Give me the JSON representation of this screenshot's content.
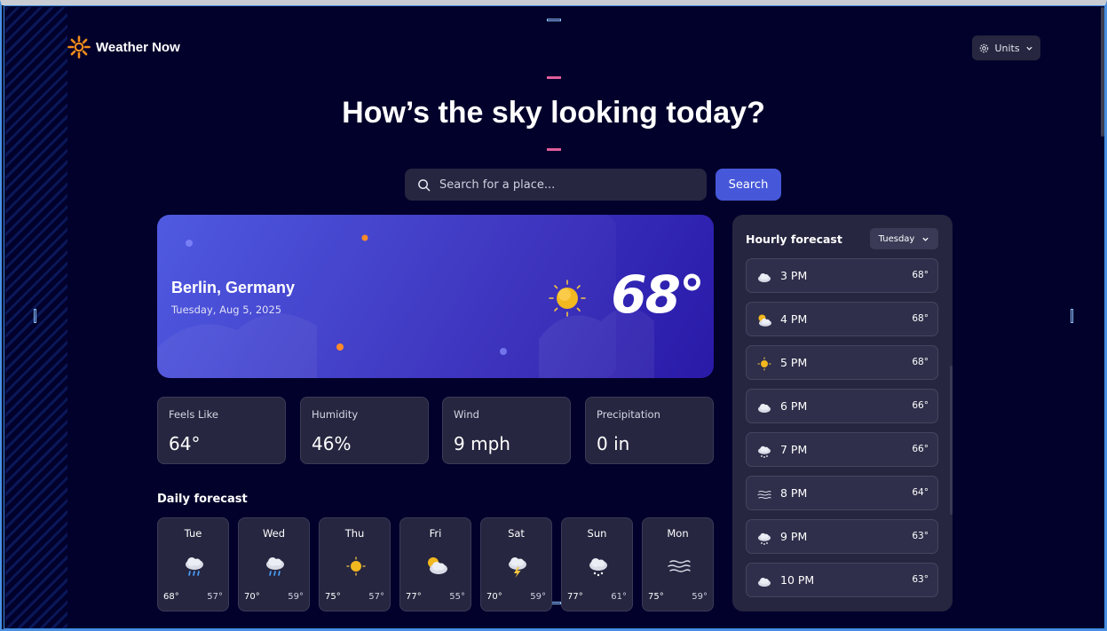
{
  "app": {
    "title": "Weather Now",
    "units_label": "Units"
  },
  "hero": {
    "title": "How’s the sky looking today?"
  },
  "search": {
    "placeholder": "Search for a place...",
    "button_label": "Search"
  },
  "current": {
    "city": "Berlin, Germany",
    "date": "Tuesday, Aug 5, 2025",
    "temp": "68°",
    "icon": "sun-icon"
  },
  "stats": [
    {
      "label": "Feels Like",
      "value": "64°"
    },
    {
      "label": "Humidity",
      "value": "46%"
    },
    {
      "label": "Wind",
      "value": "9 mph"
    },
    {
      "label": "Precipitation",
      "value": "0 in"
    }
  ],
  "daily": {
    "title": "Daily forecast",
    "days": [
      {
        "name": "Tue",
        "hi": "68°",
        "lo": "57°",
        "icon": "rain-cloud-icon"
      },
      {
        "name": "Wed",
        "hi": "70°",
        "lo": "59°",
        "icon": "rain-cloud-icon"
      },
      {
        "name": "Thu",
        "hi": "75°",
        "lo": "57°",
        "icon": "sun-icon"
      },
      {
        "name": "Fri",
        "hi": "77°",
        "lo": "55°",
        "icon": "partly-cloudy-icon"
      },
      {
        "name": "Sat",
        "hi": "70°",
        "lo": "59°",
        "icon": "storm-icon"
      },
      {
        "name": "Sun",
        "hi": "77°",
        "lo": "61°",
        "icon": "snow-cloud-icon"
      },
      {
        "name": "Mon",
        "hi": "75°",
        "lo": "59°",
        "icon": "fog-icon"
      }
    ]
  },
  "hourly": {
    "title": "Hourly forecast",
    "day_selected": "Tuesday",
    "hours": [
      {
        "time": "3 PM",
        "temp": "68°",
        "icon": "cloud-icon"
      },
      {
        "time": "4 PM",
        "temp": "68°",
        "icon": "partly-cloudy-icon"
      },
      {
        "time": "5 PM",
        "temp": "68°",
        "icon": "sun-icon"
      },
      {
        "time": "6 PM",
        "temp": "66°",
        "icon": "cloud-icon"
      },
      {
        "time": "7 PM",
        "temp": "66°",
        "icon": "snow-cloud-icon"
      },
      {
        "time": "8 PM",
        "temp": "64°",
        "icon": "fog-icon"
      },
      {
        "time": "9 PM",
        "temp": "63°",
        "icon": "snow-cloud-icon"
      },
      {
        "time": "10 PM",
        "temp": "63°",
        "icon": "cloud-icon"
      }
    ]
  },
  "colors": {
    "background": "#02012b",
    "card": "#262640",
    "accent": "#4658d9",
    "logo": "#f28c1c"
  }
}
